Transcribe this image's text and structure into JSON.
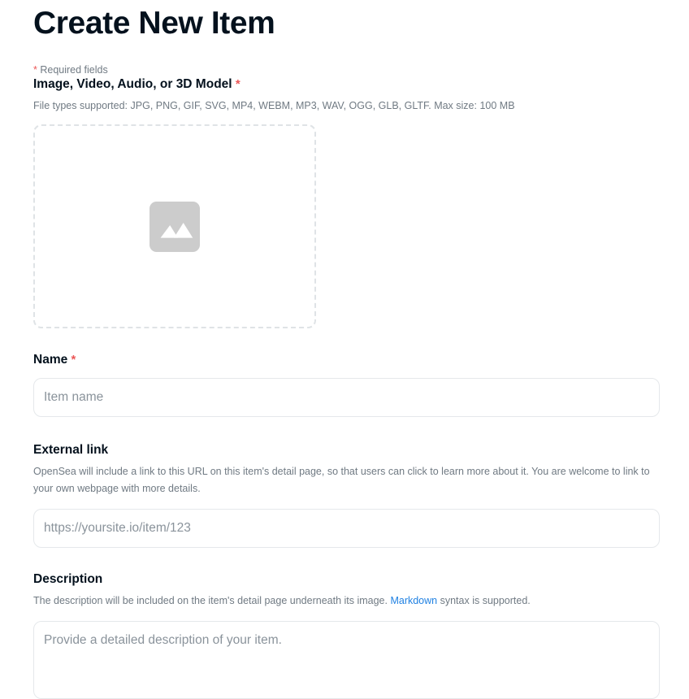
{
  "page": {
    "title": "Create New Item",
    "required_note_asterisk": "*",
    "required_note_text": " Required fields"
  },
  "media_field": {
    "label": "Image, Video, Audio, or 3D Model",
    "required_marker": "*",
    "help": "File types supported: JPG, PNG, GIF, SVG, MP4, WEBM, MP3, WAV, OGG, GLB, GLTF. Max size: 100 MB",
    "dropzone_icon": "image-placeholder-icon",
    "file_types": [
      "JPG",
      "PNG",
      "GIF",
      "SVG",
      "MP4",
      "WEBM",
      "MP3",
      "WAV",
      "OGG",
      "GLB",
      "GLTF"
    ],
    "max_size": "100 MB"
  },
  "name_field": {
    "label": "Name",
    "required_marker": "*",
    "placeholder": "Item name",
    "value": ""
  },
  "external_link_field": {
    "label": "External link",
    "help": "OpenSea will include a link to this URL on this item's detail page, so that users can click to learn more about it. You are welcome to link to your own webpage with more details.",
    "placeholder": "https://yoursite.io/item/123",
    "value": ""
  },
  "description_field": {
    "label": "Description",
    "help_before_link": "The description will be included on the item's detail page underneath its image. ",
    "help_link_text": "Markdown",
    "help_after_link": " syntax is supported.",
    "placeholder": "Provide a detailed description of your item.",
    "value": ""
  },
  "colors": {
    "heading": "#04111d",
    "muted_text": "#707a83",
    "placeholder": "#8a939b",
    "required_red": "#eb5757",
    "link_blue": "#2081e2",
    "border": "#e5e8eb",
    "dashed_border": "#dfe3e6",
    "icon_gray": "#cccccc",
    "background": "#ffffff"
  }
}
